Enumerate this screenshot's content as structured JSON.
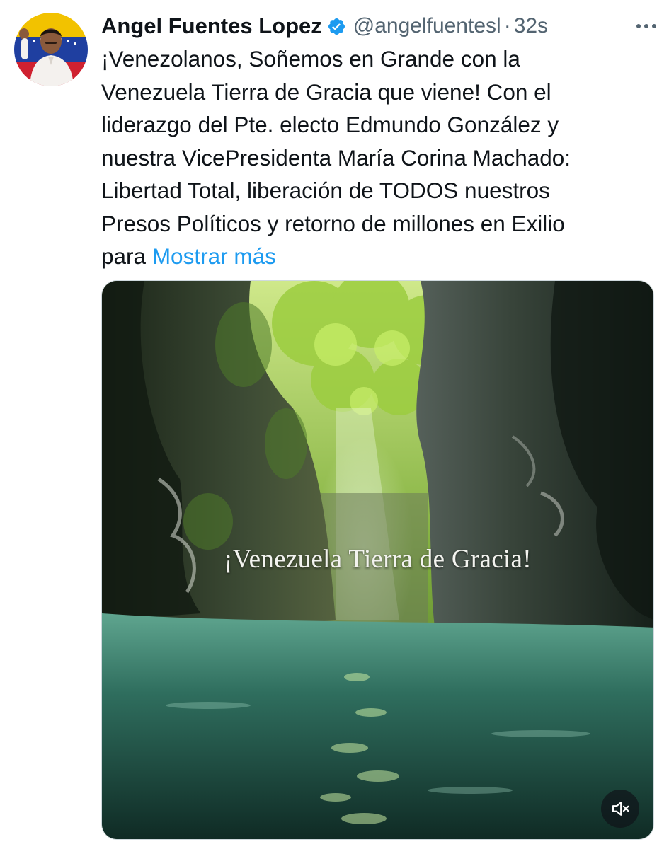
{
  "author": {
    "display_name": "Angel Fuentes Lopez",
    "handle": "@angelfuentesl",
    "separator": "·",
    "time": "32s",
    "verified": true,
    "avatar_icon": "avatar-photo-with-flag"
  },
  "tweet": {
    "text": "¡Venezolanos, Soñemos en Grande con la\nVenezuela Tierra de Gracia que viene! Con el\nliderazgo del Pte. electo Edmundo González y\nnuestra VicePresidenta María Corina Machado:\nLibertad Total, liberación de TODOS nuestros\nPresos Políticos y retorno de millones en Exilio\npara ",
    "show_more_label": "Mostrar más"
  },
  "media": {
    "type": "video",
    "overlay_text": "¡Venezuela Tierra de Gracia!",
    "muted": true,
    "mute_icon": "speaker-muted-icon"
  },
  "colors": {
    "text": "#0f1419",
    "secondary": "#536471",
    "link": "#1d9bf0",
    "verified": "#1d9bf0"
  }
}
